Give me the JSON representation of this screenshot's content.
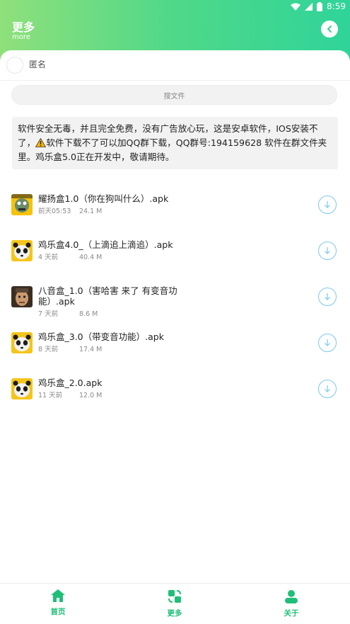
{
  "status": {
    "time": "8:59"
  },
  "header": {
    "title": "更多",
    "subtitle": "more",
    "back_icon": "chevron-left-icon"
  },
  "anon": {
    "label": "匿名"
  },
  "search": {
    "placeholder": "搜文件"
  },
  "notice": {
    "part1": "软件安全无毒，并且完全免费，没有广告放心玩，这是安卓软件，IOS安装不了，",
    "part2": "软件下载不了可以加QQ群下载，QQ群号:194159628 软件在群文件夹里。鸡乐盒5.0正在开发中，敬请期待。"
  },
  "files": [
    {
      "name": "耀扬盒1.0（你在狗叫什么）.apk",
      "time": "前天05:53",
      "size": "24.1 M",
      "thumb": "yellow-sticker"
    },
    {
      "name": "鸡乐盒4.0_（上滴追上滴追）.apk",
      "time": "4 天前",
      "size": "40.4 M",
      "thumb": "panda"
    },
    {
      "name": "八音盒_1.0（害哈害 来了 有变音功能）.apk",
      "time": "7 天前",
      "size": "8.6 M",
      "thumb": "man-face"
    },
    {
      "name": "鸡乐盒_3.0（带变音功能）.apk",
      "time": "8 天前",
      "size": "17.4 M",
      "thumb": "panda"
    },
    {
      "name": "鸡乐盒_2.0.apk",
      "time": "11 天前",
      "size": "12.0 M",
      "thumb": "panda"
    }
  ],
  "tabs": [
    {
      "label": "首页",
      "icon": "home-icon"
    },
    {
      "label": "更多",
      "icon": "transfer-icon"
    },
    {
      "label": "关于",
      "icon": "user-icon"
    }
  ],
  "colors": {
    "accent": "#1fbf78",
    "header_start": "#8fe07b",
    "header_end": "#2fd49a",
    "download": "#7cc8ee"
  }
}
